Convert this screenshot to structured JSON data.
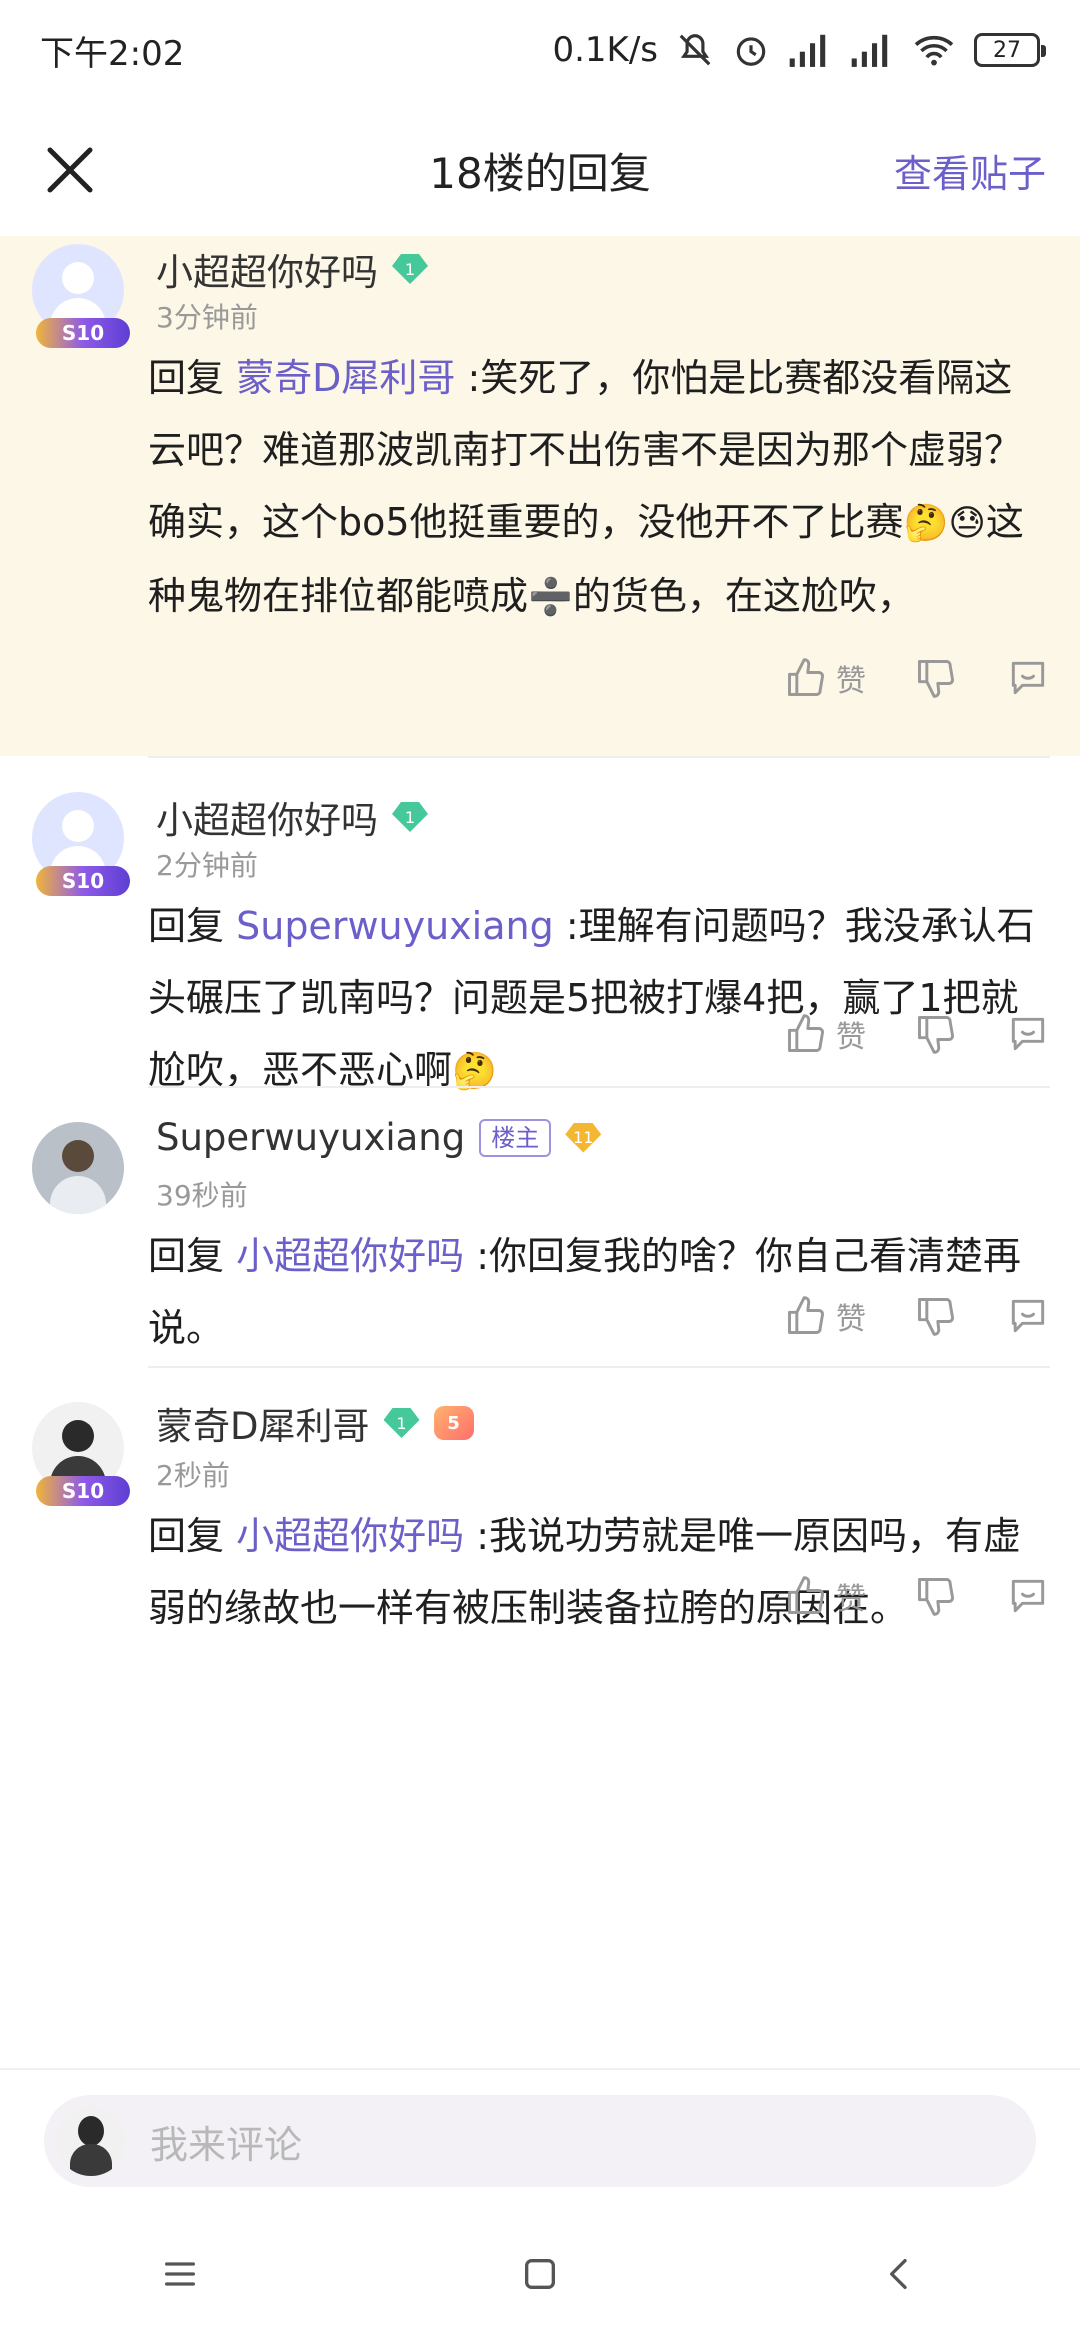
{
  "status_bar": {
    "time": "下午2:02",
    "net_speed": "0.1K/s",
    "battery": "27",
    "icons": [
      "mute-icon",
      "alarm-icon",
      "signal-icon",
      "signal-icon",
      "wifi-icon",
      "battery-icon"
    ]
  },
  "header": {
    "title": "18楼的回复",
    "view_post": "查看贴子",
    "close_icon": "close-icon"
  },
  "colors": {
    "accent": "#6b5fc9",
    "highlight_bg": "#fdf7e7",
    "level_green": "#45c99a",
    "level_gold": "#f3b733"
  },
  "comments": [
    {
      "username": "小超超你好吗",
      "level": "1",
      "avatar_badge": "S10",
      "time": "3分钟前",
      "reply_prefix": "回复",
      "reply_to": "蒙奇D犀利哥",
      "text": ":笑死了，你怕是比赛都没看隔这云吧？难道那波凯南打不出伤害不是因为那个虚弱？确实，这个bo5他挺重要的，没他开不了比赛",
      "emoji1": "🤔",
      "emoji2": "😓",
      "text2": "这种鬼物在排位都能喷成",
      "emoji3": "➗",
      "text3": "的货色，在这尬吹，",
      "like_label": "赞",
      "highlight": true
    },
    {
      "username": "小超超你好吗",
      "level": "1",
      "avatar_badge": "S10",
      "time": "2分钟前",
      "reply_prefix": "回复",
      "reply_to": "Superwuyuxiang",
      "text": ":理解有问题吗？我没承认石头碾压了凯南吗？问题是5把被打爆4把，赢了1把就尬吹，恶不恶心啊",
      "emoji1": "🤔",
      "like_label": "赞"
    },
    {
      "username": "Superwuyuxiang",
      "owner_tag": "楼主",
      "level": "11",
      "time": "39秒前",
      "reply_prefix": "回复",
      "reply_to": "小超超你好吗",
      "text": ":你回复我的啥？你自己看清楚再说。",
      "like_label": "赞"
    },
    {
      "username": "蒙奇D犀利哥",
      "level": "1",
      "game_badge": "5",
      "avatar_badge": "S10",
      "time": "2秒前",
      "reply_prefix": "回复",
      "reply_to": "小超超你好吗",
      "text": ":我说功劳就是唯一原因吗，有虚弱的缘故也一样有被压制装备拉胯的原因在。",
      "like_label": "赞"
    }
  ],
  "input": {
    "placeholder": "我来评论"
  },
  "nav": {
    "icons": [
      "menu-icon",
      "home-icon",
      "back-icon"
    ]
  }
}
